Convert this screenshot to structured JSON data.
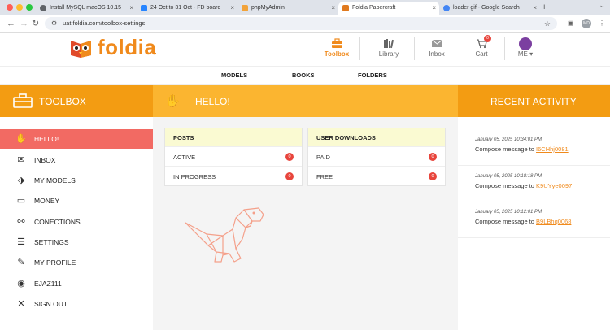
{
  "browser": {
    "tabs": [
      {
        "title": "Install MySQL macOS 10.15",
        "fav_color": "#5f6368"
      },
      {
        "title": "24 Oct to 31 Oct - FD board",
        "fav_color": "#2684ff"
      },
      {
        "title": "phpMyAdmin",
        "fav_color": "#f2a33a"
      },
      {
        "title": "Foldia Papercraft",
        "fav_color": "#e07a1f"
      },
      {
        "title": "loader gif - Google Search",
        "fav_color": "#4285f4"
      }
    ],
    "url": "uat.foldia.com/toolbox-settings",
    "profile_initials": "MD"
  },
  "site": {
    "logo_text": "foldia",
    "brand_color": "#f08a1c",
    "header_nav": [
      {
        "label": "Toolbox",
        "icon": "toolbox-icon"
      },
      {
        "label": "Library",
        "icon": "library-icon"
      },
      {
        "label": "Inbox",
        "icon": "inbox-icon"
      },
      {
        "label": "Cart",
        "icon": "cart-icon",
        "badge": "0"
      },
      {
        "label": "ME",
        "icon": "avatar"
      }
    ],
    "submenu": [
      "MODELS",
      "BOOKS",
      "FOLDERS"
    ]
  },
  "bars": {
    "toolbox_title": "TOOLBOX",
    "hello_title": "HELLO!",
    "recent_title": "RECENT ACTIVITY"
  },
  "sidebar": {
    "items": [
      {
        "label": "HELLO!",
        "icon": "wave-icon"
      },
      {
        "label": "INBOX",
        "icon": "envelope-icon"
      },
      {
        "label": "MY MODELS",
        "icon": "models-icon"
      },
      {
        "label": "MONEY",
        "icon": "money-icon"
      },
      {
        "label": "CONECTIONS",
        "icon": "connections-icon"
      },
      {
        "label": "SETTINGS",
        "icon": "settings-icon"
      },
      {
        "label": "MY PROFILE",
        "icon": "pencil-icon"
      },
      {
        "label": "EJAZ111",
        "icon": "user-icon"
      },
      {
        "label": "SIGN OUT",
        "icon": "close-icon"
      }
    ]
  },
  "cards": {
    "posts": {
      "title": "POSTS",
      "rows": [
        {
          "label": "ACTIVE",
          "count": "0"
        },
        {
          "label": "IN PROGRESS",
          "count": "0"
        }
      ]
    },
    "downloads": {
      "title": "USER DOWNLOADS",
      "rows": [
        {
          "label": "PAID",
          "count": "0"
        },
        {
          "label": "FREE",
          "count": "0"
        }
      ]
    }
  },
  "activity": [
    {
      "time": "January 05, 2025 10:34:01 PM",
      "prefix": "Compose message to",
      "link": "I6CHhj0081"
    },
    {
      "time": "January 05, 2025 10:18:18 PM",
      "prefix": "Compose message to",
      "link": "K9UYye0097"
    },
    {
      "time": "January 05, 2025 10:12:01 PM",
      "prefix": "Compose message to",
      "link": "B9LBhq0068"
    }
  ]
}
